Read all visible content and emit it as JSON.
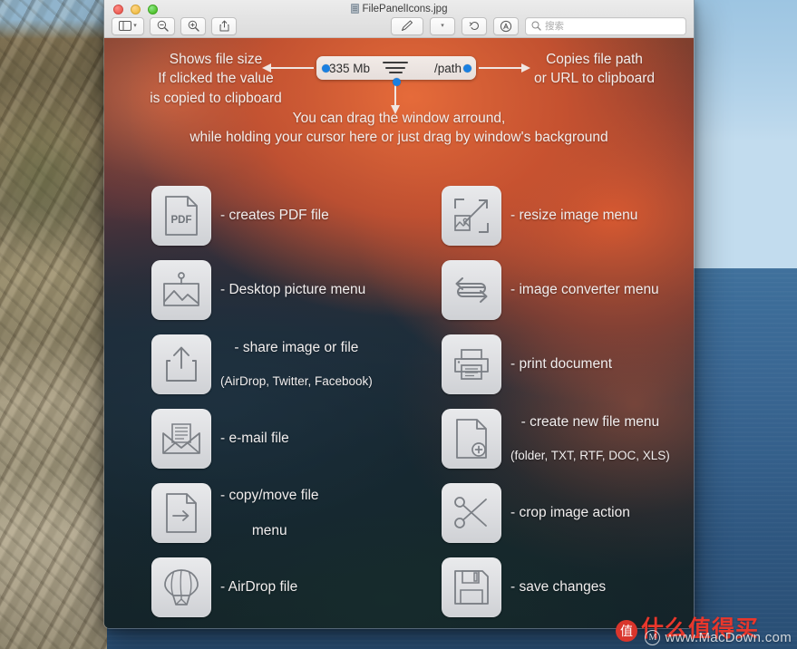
{
  "window": {
    "title": "FilePanelIcons.jpg",
    "title_icon": "document-icon",
    "traffic_lights": [
      {
        "name": "close-button",
        "color": "#ec5f57"
      },
      {
        "name": "minimize-button",
        "color": "#f0bf4c"
      },
      {
        "name": "zoom-button",
        "color": "#53c22e"
      }
    ],
    "toolbar": {
      "sidebar_toggle": "sidebar-toggle",
      "zoom_out": "zoom-out",
      "zoom_in": "zoom-in",
      "share": "share",
      "markup": "markup-pen",
      "markup_chevron": "⌄",
      "rotate": "rotate",
      "annotate": "annotate",
      "search_placeholder": "搜索"
    }
  },
  "image": {
    "annotations": {
      "left": "Shows file size\nIf clicked the value\nis copied to clipboard",
      "right": "Copies file path\nor URL to clipboard",
      "bottom": "You can drag the window arround,\nwhile holding your cursor here or just drag by window's background"
    },
    "file_panel": {
      "size_label": "335 Mb",
      "path_label": "/path",
      "menu_icon": "hamburger-menu-icon",
      "dot_color": "#1a7fe0"
    },
    "icons_left": [
      {
        "icon": "pdf-file-icon",
        "label": "- creates PDF file",
        "sub": "",
        "center": false
      },
      {
        "icon": "picture-frame-icon",
        "label": "- Desktop picture menu",
        "sub": "",
        "center": false
      },
      {
        "icon": "share-upload-icon",
        "label": "- share image or file",
        "sub": "(AirDrop, Twitter, Facebook)",
        "center": true
      },
      {
        "icon": "envelope-mail-icon",
        "label": "- e-mail file",
        "sub": "",
        "center": false
      },
      {
        "icon": "file-arrow-icon",
        "label": "- copy/move file",
        "sub": "menu",
        "center": true
      },
      {
        "icon": "airdrop-icon",
        "label": "- AirDrop file",
        "sub": "",
        "center": false
      }
    ],
    "icons_right": [
      {
        "icon": "resize-image-icon",
        "label": "- resize image menu",
        "sub": "",
        "center": false
      },
      {
        "icon": "convert-arrows-icon",
        "label": "- image converter menu",
        "sub": "",
        "center": false
      },
      {
        "icon": "printer-icon",
        "label": "- print document",
        "sub": "",
        "center": false
      },
      {
        "icon": "new-file-plus-icon",
        "label": "- create new file menu",
        "sub": "(folder, TXT, RTF, DOC, XLS)",
        "center": true
      },
      {
        "icon": "scissors-icon",
        "label": "- crop image action",
        "sub": "",
        "center": false
      },
      {
        "icon": "floppy-save-icon",
        "label": "- save changes",
        "sub": "",
        "center": false
      }
    ]
  },
  "watermark": {
    "logo": "M",
    "url": "www.MacDown.com",
    "badge": "值",
    "chinese": "什么值得买"
  }
}
